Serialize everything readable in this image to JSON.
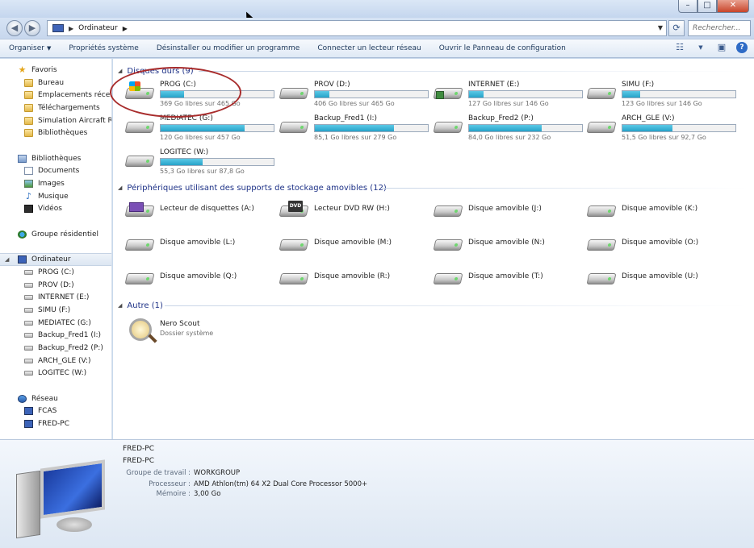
{
  "window": {
    "controls": {
      "minimize": "–",
      "maximize": "□",
      "close": "✕"
    }
  },
  "address": {
    "crumb": "Ordinateur",
    "search_placeholder": "Rechercher..."
  },
  "toolbar": {
    "organize": "Organiser",
    "properties": "Propriétés système",
    "uninstall": "Désinstaller ou modifier un programme",
    "map_drive": "Connecter un lecteur réseau",
    "control_panel": "Ouvrir le Panneau de configuration"
  },
  "sidebar": {
    "favorites": "Favoris",
    "favorites_items": [
      "Bureau",
      "Emplacements récents",
      "Téléchargements",
      "Simulation Aircraft Repa",
      "Bibliothèques"
    ],
    "libraries": "Bibliothèques",
    "libraries_items": [
      "Documents",
      "Images",
      "Musique",
      "Vidéos"
    ],
    "homegroup": "Groupe résidentiel",
    "computer": "Ordinateur",
    "computer_items": [
      "PROG (C:)",
      "PROV (D:)",
      "INTERNET (E:)",
      "SIMU (F:)",
      "MEDIATEC (G:)",
      "Backup_Fred1 (I:)",
      "Backup_Fred2 (P:)",
      "ARCH_GLE (V:)",
      "LOGITEC (W:)"
    ],
    "network": "Réseau",
    "network_items": [
      "FCAS",
      "FRED-PC"
    ]
  },
  "groups": {
    "hdd": "Disques durs (9)",
    "removable": "Périphériques utilisant des supports de stockage amovibles (12)",
    "other": "Autre (1)"
  },
  "drives": [
    {
      "name": "PROG (C:)",
      "free": "369 Go libres sur 465 Go",
      "used_fraction": 0.21,
      "icon": "windows-drive-icon"
    },
    {
      "name": "PROV (D:)",
      "free": "406 Go libres sur 465 Go",
      "used_fraction": 0.13,
      "icon": "hard-drive-icon"
    },
    {
      "name": "INTERNET (E:)",
      "free": "127 Go libres sur 146 Go",
      "used_fraction": 0.13,
      "icon": "network-drive-icon"
    },
    {
      "name": "SIMU (F:)",
      "free": "123 Go libres sur 146 Go",
      "used_fraction": 0.16,
      "icon": "hard-drive-icon"
    },
    {
      "name": "MEDIATEC (G:)",
      "free": "120 Go libres sur 457 Go",
      "used_fraction": 0.74,
      "icon": "hard-drive-icon"
    },
    {
      "name": "Backup_Fred1 (I:)",
      "free": "85,1 Go libres sur 279 Go",
      "used_fraction": 0.7,
      "icon": "hard-drive-icon"
    },
    {
      "name": "Backup_Fred2 (P:)",
      "free": "84,0 Go libres sur 232 Go",
      "used_fraction": 0.64,
      "icon": "hard-drive-icon"
    },
    {
      "name": "ARCH_GLE (V:)",
      "free": "51,5 Go libres sur 92,7 Go",
      "used_fraction": 0.44,
      "icon": "hard-drive-icon"
    },
    {
      "name": "LOGITEC (W:)",
      "free": "55,3 Go libres sur 87,8 Go",
      "used_fraction": 0.37,
      "icon": "hard-drive-icon"
    }
  ],
  "removables": [
    {
      "name": "Lecteur de disquettes (A:)",
      "icon": "floppy-drive-icon"
    },
    {
      "name": "Lecteur DVD RW (H:)",
      "icon": "dvd-drive-icon"
    },
    {
      "name": "Disque amovible (J:)",
      "icon": "removable-drive-icon"
    },
    {
      "name": "Disque amovible (K:)",
      "icon": "removable-drive-icon"
    },
    {
      "name": "Disque amovible (L:)",
      "icon": "removable-drive-icon"
    },
    {
      "name": "Disque amovible (M:)",
      "icon": "removable-drive-icon"
    },
    {
      "name": "Disque amovible (N:)",
      "icon": "removable-drive-icon"
    },
    {
      "name": "Disque amovible (O:)",
      "icon": "removable-drive-icon"
    },
    {
      "name": "Disque amovible (Q:)",
      "icon": "removable-drive-icon"
    },
    {
      "name": "Disque amovible (R:)",
      "icon": "removable-drive-icon"
    },
    {
      "name": "Disque amovible (T:)",
      "icon": "removable-drive-icon"
    },
    {
      "name": "Disque amovible (U:)",
      "icon": "removable-drive-icon"
    }
  ],
  "other": [
    {
      "name": "Nero Scout",
      "type": "Dossier système",
      "icon": "nero-scout-icon"
    }
  ],
  "details": {
    "name_line1": "FRED-PC",
    "name_line2": "FRED-PC",
    "workgroup_label": "Groupe de travail :",
    "workgroup_value": "WORKGROUP",
    "processor_label": "Processeur :",
    "processor_value": "AMD Athlon(tm) 64 X2 Dual Core Processor 5000+",
    "memory_label": "Mémoire :",
    "memory_value": "3,00 Go"
  },
  "colors": {
    "accent_bar": "#26a3c9",
    "group_header": "#1e3287",
    "annotation_circle": "#a82c2c"
  }
}
